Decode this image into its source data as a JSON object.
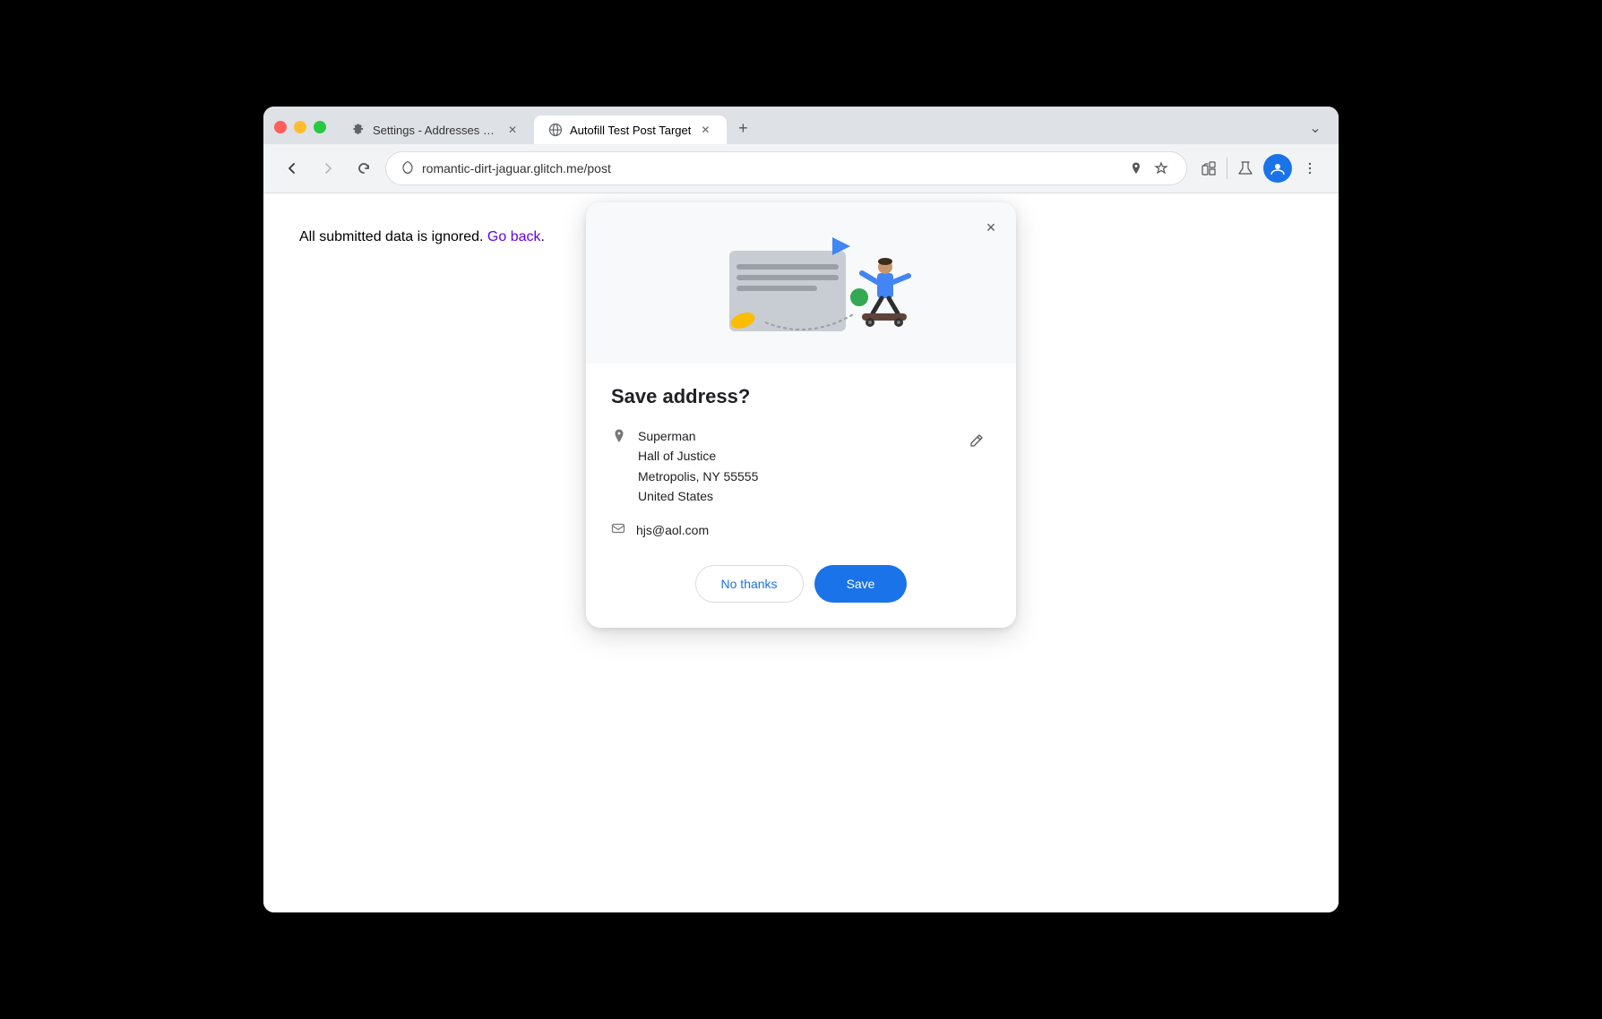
{
  "browser": {
    "tabs": [
      {
        "id": "tab-settings",
        "title": "Settings - Addresses and mo",
        "icon": "gear",
        "active": false,
        "closeable": true
      },
      {
        "id": "tab-autofill",
        "title": "Autofill Test Post Target",
        "icon": "globe",
        "active": true,
        "closeable": true
      }
    ],
    "url": "romantic-dirt-jaguar.glitch.me/post",
    "nav": {
      "back_disabled": false,
      "forward_disabled": true
    }
  },
  "page": {
    "text": "All submitted data is ignored.",
    "link_text": "Go back",
    "period": "."
  },
  "popup": {
    "title": "Save address?",
    "close_label": "×",
    "address": {
      "name": "Superman",
      "street": "Hall of Justice",
      "city_state_zip": "Metropolis, NY 55555",
      "country": "United States"
    },
    "email": "hjs@aol.com",
    "buttons": {
      "no_thanks": "No thanks",
      "save": "Save"
    }
  }
}
